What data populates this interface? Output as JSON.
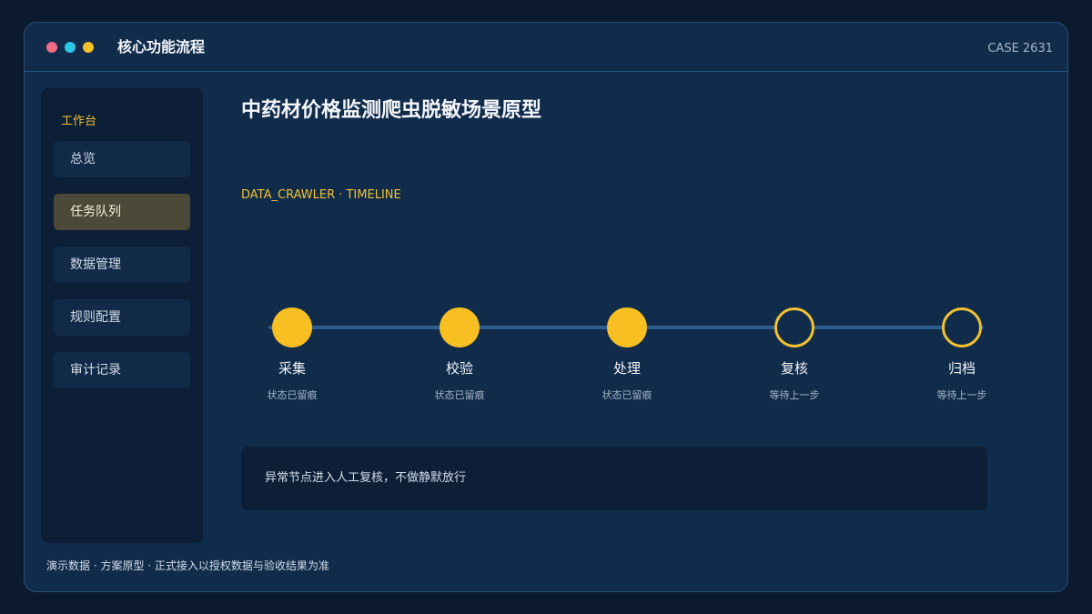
{
  "window": {
    "title": "核心功能流程",
    "case_id": "CASE 2631",
    "controls": [
      {
        "icon": "red-dot-icon",
        "color": "#ef6b86"
      },
      {
        "icon": "cyan-dot-icon",
        "color": "#2cc6e8"
      },
      {
        "icon": "yellow-dot-icon",
        "color": "#f5c02a"
      }
    ]
  },
  "sidebar": {
    "heading": "工作台",
    "items": [
      {
        "label": "总览",
        "active": false
      },
      {
        "label": "任务队列",
        "active": true
      },
      {
        "label": "数据管理",
        "active": false
      },
      {
        "label": "规则配置",
        "active": false
      },
      {
        "label": "审计记录",
        "active": false
      }
    ]
  },
  "main": {
    "title": "中药材价格监测爬虫脱敏场景原型",
    "subtitle": "DATA_CRAWLER · TIMELINE",
    "steps": [
      {
        "label": "采集",
        "status": "状态已留痕",
        "state": "done"
      },
      {
        "label": "校验",
        "status": "状态已留痕",
        "state": "done"
      },
      {
        "label": "处理",
        "status": "状态已留痕",
        "state": "done"
      },
      {
        "label": "复核",
        "status": "等待上一步",
        "state": "pending"
      },
      {
        "label": "归档",
        "status": "等待上一步",
        "state": "pending"
      }
    ],
    "notice": "异常节点进入人工复核，不做静默放行"
  },
  "footer": "演示数据 · 方案原型 · 正式接入以授权数据与验收结果为准",
  "colors": {
    "accent": "#f2c230",
    "step_done": "#f7bf22",
    "track": "#2d5e8c",
    "panel": "#112c4b",
    "background": "#0b1a2e"
  }
}
